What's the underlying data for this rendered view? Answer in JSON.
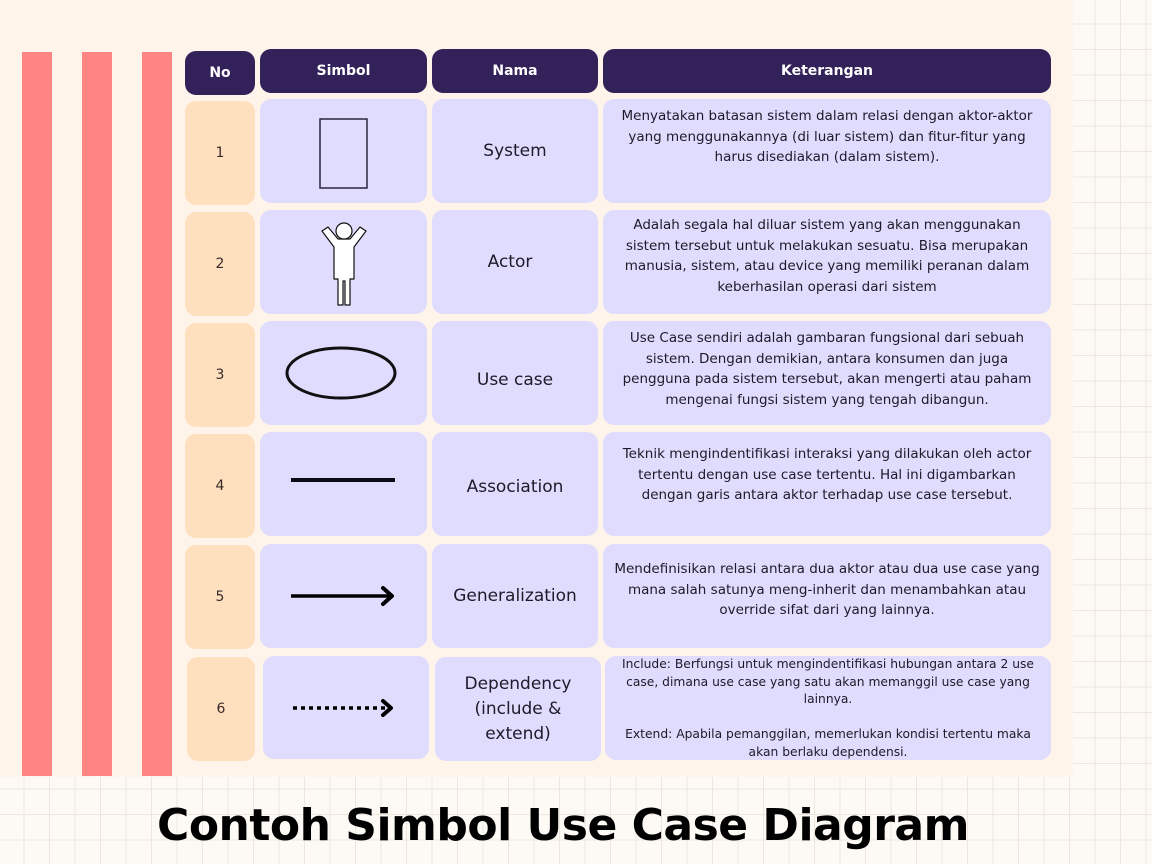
{
  "title": "Contoh Simbol Use Case Diagram",
  "colors": {
    "header": "#33215a",
    "number_cell": "#fee0bf",
    "content_cell": "#e0dcfd",
    "stripe": "#fe8583",
    "panel": "#fff4ea"
  },
  "table": {
    "headers": [
      "No",
      "Simbol",
      "Nama",
      "Keterangan"
    ],
    "rows": [
      {
        "no": "1",
        "symbol_icon": "system-boundary-rectangle-icon",
        "name": "System",
        "description": "Menyatakan batasan sistem dalam relasi dengan aktor-aktor yang menggunakannya (di luar sistem) dan fitur-fitur yang harus disediakan (dalam sistem)."
      },
      {
        "no": "2",
        "symbol_icon": "actor-stick-figure-icon",
        "name": "Actor",
        "description": "Adalah segala hal diluar sistem yang akan menggunakan sistem tersebut untuk melakukan sesuatu. Bisa merupakan manusia, sistem, atau device yang memiliki peranan dalam keberhasilan operasi dari sistem"
      },
      {
        "no": "3",
        "symbol_icon": "use-case-ellipse-icon",
        "name": "Use case",
        "description": "Use Case sendiri adalah gambaran fungsional dari sebuah sistem. Dengan demikian, antara konsumen dan juga pengguna pada sistem tersebut, akan mengerti atau paham mengenai fungsi sistem yang tengah dibangun."
      },
      {
        "no": "4",
        "symbol_icon": "association-line-icon",
        "name": "Association",
        "description": "Teknik mengindentifikasi interaksi yang dilakukan oleh actor tertentu dengan use case tertentu. Hal ini digambarkan dengan garis antara aktor terhadap use case tersebut."
      },
      {
        "no": "5",
        "symbol_icon": "generalization-arrow-icon",
        "name": "Generalization",
        "description": "Mendefinisikan relasi antara dua aktor atau dua use case yang mana salah satunya meng-inherit dan menambahkan atau override sifat dari yang lainnya."
      },
      {
        "no": "6",
        "symbol_icon": "dependency-dotted-arrow-icon",
        "name": "Dependency (include & extend)",
        "description": "Include: Berfungsi untuk mengindentifikasi hubungan antara 2 use case, dimana use case yang satu akan memanggil use case yang lainnya.\n\nExtend: Apabila pemanggilan, memerlukan kondisi tertentu maka akan berlaku dependensi."
      }
    ]
  }
}
